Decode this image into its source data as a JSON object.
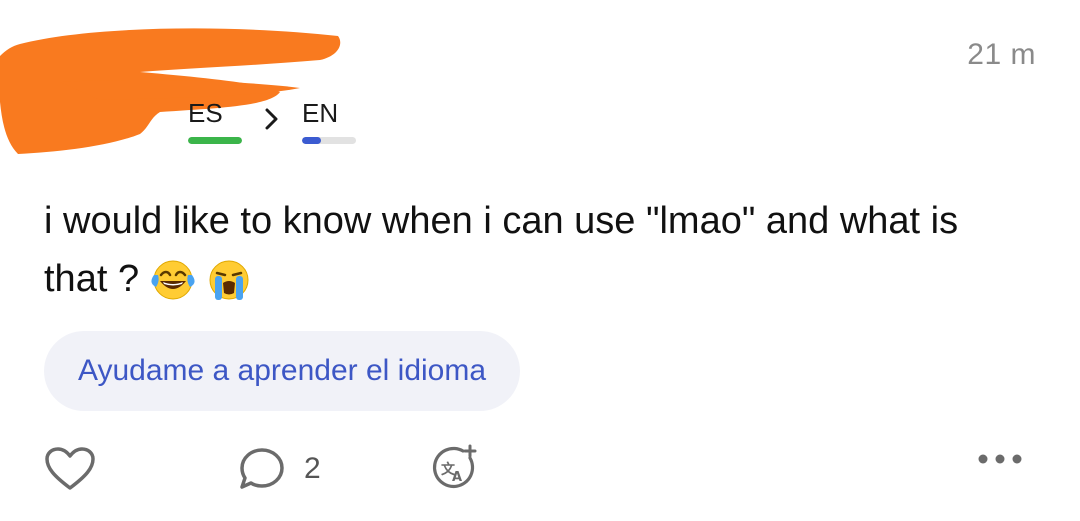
{
  "post": {
    "timestamp": "21 m",
    "languages": {
      "native": {
        "code": "ES",
        "level": 1.0,
        "color": "#3bb54a"
      },
      "learning": {
        "code": "EN",
        "level": 0.35,
        "color": "#3b5bd1"
      }
    },
    "text": "i would like to know when i can use \"lmao\" and what is that ?",
    "emojis": [
      "face-with-tears-of-joy",
      "loudly-crying-face"
    ],
    "help_chip_label": "Ayudame a aprender el idioma",
    "actions": {
      "comment_count": "2",
      "icons": [
        "heart-icon",
        "comment-icon",
        "translate-icon",
        "more-icon"
      ]
    }
  },
  "colors": {
    "accent": "#3d57c5",
    "redaction": "#f97a1f",
    "chip_bg": "#f1f2f8"
  }
}
